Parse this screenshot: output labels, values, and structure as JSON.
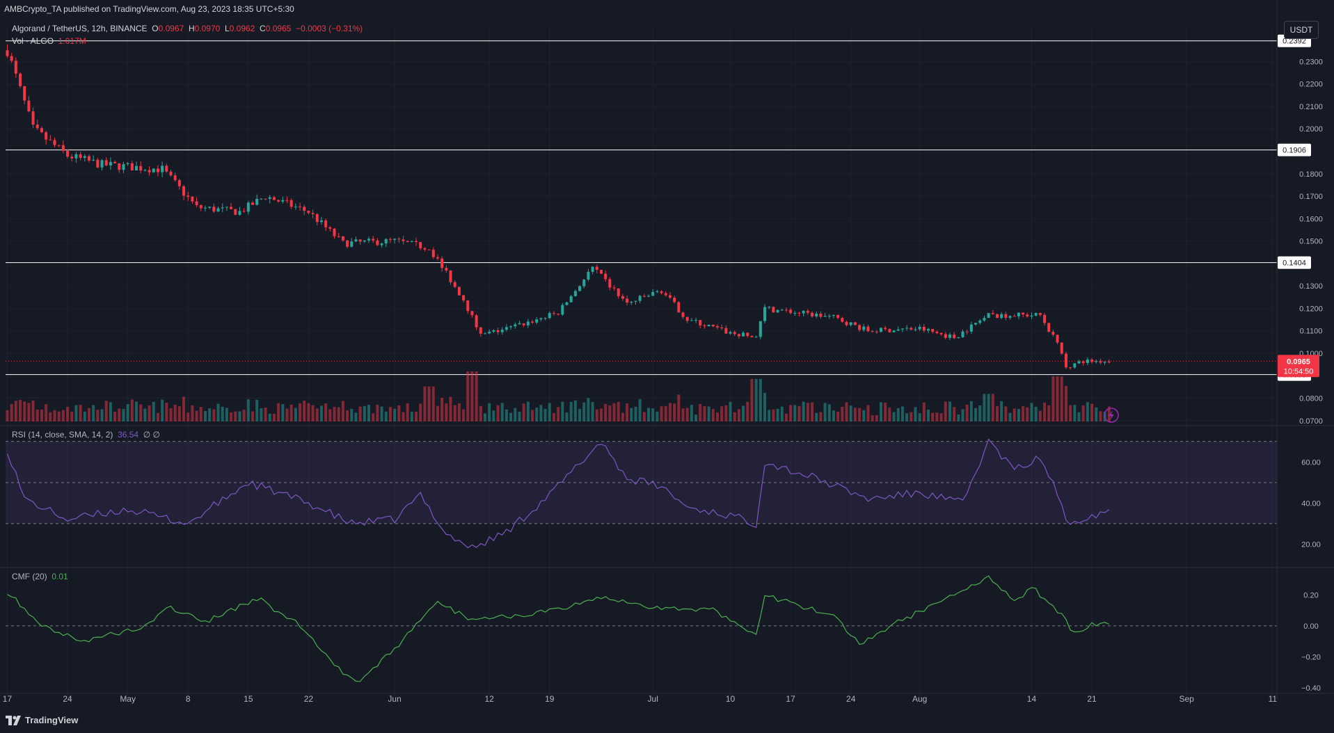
{
  "publisher_line": "AMBCrypto_TA published on TradingView.com, Aug 23, 2023 18:35 UTC+5:30",
  "symbol": {
    "name": "Algorand / TetherUS, 12h, BINANCE",
    "o_label": "O",
    "o": "0.0967",
    "h_label": "H",
    "h": "0.0970",
    "l_label": "L",
    "l": "0.0962",
    "c_label": "C",
    "c": "0.0965",
    "change": "−0.0003 (−0.31%)"
  },
  "volume": {
    "label": "Vol · ALGO",
    "value": "1.017M"
  },
  "currency_button": "USDT",
  "rsi": {
    "label": "RSI (14, close, SMA, 14, 2)",
    "value": "36.54",
    "extra": "∅ ∅"
  },
  "cmf": {
    "label": "CMF (20)",
    "value": "0.01"
  },
  "footer": {
    "brand": "TradingView"
  },
  "colors": {
    "up": "#26a69a",
    "down": "#f23645",
    "rsi": "#7e57c2",
    "cmf": "#4caf50",
    "background": "#161a25"
  },
  "chart_data": [
    {
      "type": "candlestick",
      "title": "Algorand / TetherUS, 12h, BINANCE",
      "ylim": [
        0.069,
        0.245
      ],
      "y_ticks": [
        "0.0700",
        "0.0800",
        "0.1000",
        "0.1100",
        "0.1200",
        "0.1300",
        "0.1500",
        "0.1600",
        "0.1700",
        "0.1800",
        "0.2000",
        "0.2100",
        "0.2200",
        "0.2300"
      ],
      "horizontal_levels": [
        {
          "value": 0.2392,
          "label": "0.2392"
        },
        {
          "value": 0.1906,
          "label": "0.1906"
        },
        {
          "value": 0.1404,
          "label": "0.1404"
        },
        {
          "value": 0.0905,
          "label": "0.0905"
        }
      ],
      "current_price": {
        "value": 0.0965,
        "label": "0.0965",
        "countdown": "10:54:50"
      },
      "x_ticks": [
        "17",
        "24",
        "May",
        "8",
        "15",
        "22",
        "Jun",
        "12",
        "19",
        "Jul",
        "10",
        "17",
        "24",
        "Aug",
        "14",
        "21",
        "Sep",
        "11"
      ],
      "trend_anchors": [
        [
          "Apr 17",
          0.235
        ],
        [
          "Apr 20",
          0.2
        ],
        [
          "Apr 24",
          0.188
        ],
        [
          "Apr 28",
          0.184
        ],
        [
          "May 5",
          0.182
        ],
        [
          "May 9",
          0.165
        ],
        [
          "May 14",
          0.163
        ],
        [
          "May 17",
          0.17
        ],
        [
          "May 22",
          0.163
        ],
        [
          "May 26",
          0.149
        ],
        [
          "Jun 1",
          0.15
        ],
        [
          "Jun 5",
          0.147
        ],
        [
          "Jun 9",
          0.124
        ],
        [
          "Jun 11",
          0.108
        ],
        [
          "Jun 15",
          0.112
        ],
        [
          "Jun 20",
          0.118
        ],
        [
          "Jun 24",
          0.138
        ],
        [
          "Jun 28",
          0.122
        ],
        [
          "Jul 2",
          0.128
        ],
        [
          "Jul 5",
          0.115
        ],
        [
          "Jul 10",
          0.109
        ],
        [
          "Jul 13",
          0.107
        ],
        [
          "Jul 14",
          0.12
        ],
        [
          "Jul 18",
          0.118
        ],
        [
          "Jul 22",
          0.116
        ],
        [
          "Jul 26",
          0.11
        ],
        [
          "Aug 1",
          0.111
        ],
        [
          "Aug 5",
          0.107
        ],
        [
          "Aug 9",
          0.117
        ],
        [
          "Aug 15",
          0.117
        ],
        [
          "Aug 17",
          0.104
        ],
        [
          "Aug 18",
          0.094
        ],
        [
          "Aug 20",
          0.0965
        ],
        [
          "Aug 23",
          0.0965
        ]
      ]
    },
    {
      "type": "bar",
      "title": "Vol · ALGO",
      "current": "1.017M",
      "spikes": [
        [
          "Jun 10",
          1.0
        ],
        [
          "Jul 13",
          0.85
        ],
        [
          "Aug 17",
          0.9
        ],
        [
          "Aug 9",
          0.55
        ],
        [
          "Jun 5",
          0.7
        ]
      ]
    },
    {
      "type": "line",
      "title": "RSI (14, close, SMA, 14, 2)",
      "ylim": [
        10,
        75
      ],
      "y_ticks": [
        "60.00",
        "40.00",
        "20.00"
      ],
      "band": [
        30,
        70
      ],
      "anchors": [
        [
          "Apr 17",
          66
        ],
        [
          "Apr 19",
          42
        ],
        [
          "Apr 24",
          32
        ],
        [
          "May 1",
          37
        ],
        [
          "May 8",
          30
        ],
        [
          "May 15",
          50
        ],
        [
          "May 22",
          40
        ],
        [
          "May 27",
          30
        ],
        [
          "Jun 1",
          32
        ],
        [
          "Jun 4",
          44
        ],
        [
          "Jun 7",
          25
        ],
        [
          "Jun 10",
          18
        ],
        [
          "Jun 14",
          26
        ],
        [
          "Jun 19",
          44
        ],
        [
          "Jun 25",
          70
        ],
        [
          "Jun 28",
          52
        ],
        [
          "Jul 2",
          48
        ],
        [
          "Jul 5",
          38
        ],
        [
          "Jul 10",
          34
        ],
        [
          "Jul 13",
          30
        ],
        [
          "Jul 14",
          60
        ],
        [
          "Jul 20",
          52
        ],
        [
          "Jul 26",
          42
        ],
        [
          "Aug 1",
          45
        ],
        [
          "Aug 6",
          40
        ],
        [
          "Aug 9",
          70
        ],
        [
          "Aug 12",
          56
        ],
        [
          "Aug 15",
          62
        ],
        [
          "Aug 17",
          45
        ],
        [
          "Aug 18",
          30
        ],
        [
          "Aug 20",
          33
        ],
        [
          "Aug 23",
          36.54
        ]
      ]
    },
    {
      "type": "line",
      "title": "CMF (20)",
      "ylim": [
        -0.45,
        0.35
      ],
      "y_ticks": [
        "0.20",
        "0.00",
        "−0.20",
        "−0.40"
      ],
      "anchors": [
        [
          "Apr 17",
          0.22
        ],
        [
          "Apr 21",
          0.0
        ],
        [
          "Apr 26",
          -0.1
        ],
        [
          "May 3",
          0.0
        ],
        [
          "May 6",
          0.12
        ],
        [
          "May 10",
          0.02
        ],
        [
          "May 16",
          0.18
        ],
        [
          "May 21",
          0.0
        ],
        [
          "May 26",
          -0.3
        ],
        [
          "May 28",
          -0.36
        ],
        [
          "Jun 1",
          -0.15
        ],
        [
          "Jun 6",
          0.15
        ],
        [
          "Jun 10",
          0.04
        ],
        [
          "Jun 20",
          0.1
        ],
        [
          "Jun 25",
          0.18
        ],
        [
          "Jul 1",
          0.12
        ],
        [
          "Jul 8",
          0.1
        ],
        [
          "Jul 13",
          -0.05
        ],
        [
          "Jul 14",
          0.2
        ],
        [
          "Jul 22",
          0.06
        ],
        [
          "Jul 25",
          -0.12
        ],
        [
          "Jul 28",
          -0.02
        ],
        [
          "Aug 3",
          0.15
        ],
        [
          "Aug 9",
          0.32
        ],
        [
          "Aug 12",
          0.15
        ],
        [
          "Aug 14",
          0.25
        ],
        [
          "Aug 17",
          0.1
        ],
        [
          "Aug 19",
          -0.05
        ],
        [
          "Aug 21",
          0.02
        ],
        [
          "Aug 23",
          0.01
        ]
      ]
    }
  ]
}
